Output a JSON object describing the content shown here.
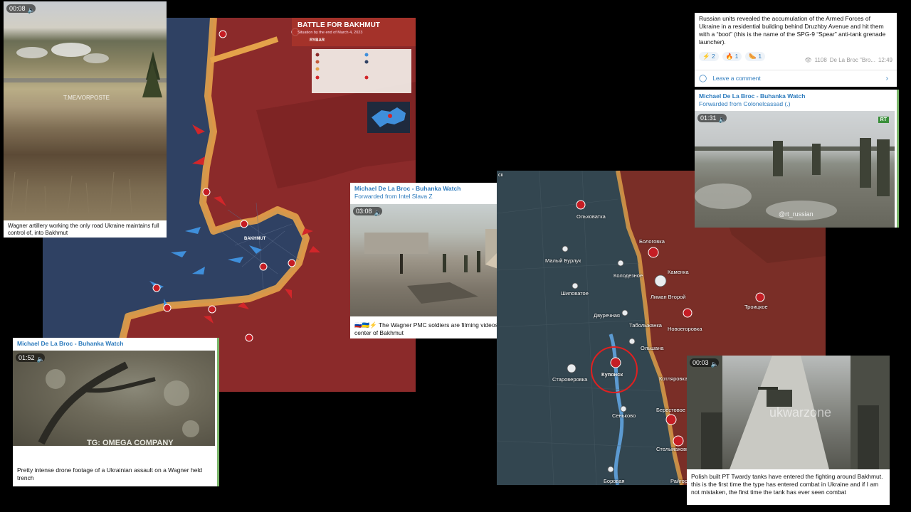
{
  "bakhmut_map": {
    "title": "BATTLE FOR BAKHMUT",
    "subtitle": "Situation by the end of March 4, 2023",
    "brand": "RYBAR",
    "city_label": "BAKHMUT"
  },
  "video_artillery": {
    "duration": "00:08",
    "watermark": "T.ME/VORPOSTE",
    "caption": "Wagner artillery working the only road Ukraine maintains full control of, into Bakhmut"
  },
  "post_drone": {
    "channel": "Michael De La Broc - Buhanka Watch",
    "duration": "01:52",
    "watermark": "TG: OMEGA COMPANY",
    "caption": "Pretty intense drone footage of a Ukrainian assault on a Wagner held trench"
  },
  "post_wagner": {
    "channel": "Michael De La Broc - Buhanka Watch",
    "forwarded": "Forwarded from Intel Slava Z",
    "duration": "03:08",
    "caption": "🇷🇺🇺🇦⚡ The Wagner PMC soldiers are filming videos almost in the center of Bakhmut"
  },
  "post_spg": {
    "text": "Russian units revealed the accumulation of the Armed Forces of Ukraine in a residential building behind Druzhby Avenue and hit them with a “boot” (this is the name of the SPG-9 “Spear” anti-tank grenade launcher).",
    "reactions": [
      {
        "emoji": "⚡",
        "count": "2"
      },
      {
        "emoji": "🔥",
        "count": "1"
      },
      {
        "emoji": "🌭",
        "count": "1"
      }
    ],
    "views": "1108",
    "author": "De La Broc \"Bro...",
    "time": "12:49",
    "comment_label": "Leave a comment"
  },
  "post_rt": {
    "channel": "Michael De La Broc - Buhanka Watch",
    "forwarded": "Forwarded from Colonelcassad (.)",
    "duration": "01:31",
    "logo": "RT",
    "watermark": "@rt_russian"
  },
  "kupyansk_map": {
    "towns": [
      "Ольховатка",
      "Бологовка",
      "Малый Бурлук",
      "Колодезное",
      "Каменка",
      "Шиповатое",
      "Лиман Второй",
      "Троицкое",
      "Двуречная",
      "Табольжанка",
      "Новоегоровка",
      "Ольшана",
      "Староверовка",
      "Купянск",
      "Котляровка",
      "Сеньково",
      "Берестовое",
      "Стельмаховка",
      "Боровая",
      "Райгородок"
    ],
    "corner_label": "ск"
  },
  "post_tank": {
    "duration": "00:03",
    "watermark": "ukwarzone",
    "caption": "Polish built PT Twardy tanks have entered the fighting around Bakhmut. this is the first time the type has entered combat in Ukraine and if I am not mistaken, the first time the tank has ever seen combat"
  },
  "colors": {
    "russian_territory": "#8b2a2a",
    "ukrainian_territory": "#2d3f5c",
    "frontline": "#e4a24a",
    "telegram_blue": "#2d7bbd"
  }
}
